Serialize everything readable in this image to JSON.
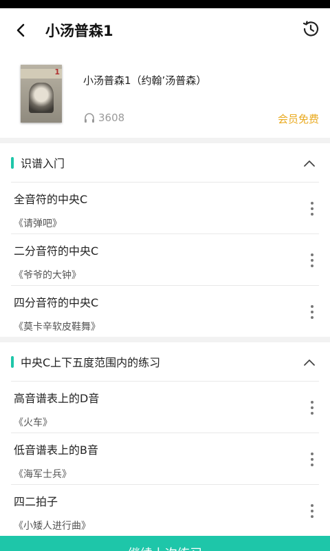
{
  "header": {
    "title": "小汤普森1",
    "back_icon": "back-arrow-icon",
    "history_icon": "history-clock-icon"
  },
  "book": {
    "title": "小汤普森1（约翰’汤普森）",
    "plays": "3608",
    "badge": "会员免费",
    "cover_number": "1",
    "badge_color": "#e9a91e"
  },
  "sections": [
    {
      "title": "识谱入门",
      "items": [
        {
          "name": "全音符的中央C",
          "sub": "《请弹吧》"
        },
        {
          "name": "二分音符的中央C",
          "sub": "《爷爷的大钟》"
        },
        {
          "name": "四分音符的中央C",
          "sub": "《莫卡辛软皮鞋舞》"
        }
      ]
    },
    {
      "title": "中央C上下五度范围内的练习",
      "items": [
        {
          "name": "高音谱表上的D音",
          "sub": "《火车》"
        },
        {
          "name": "低音谱表上的B音",
          "sub": "《海军士兵》"
        },
        {
          "name": "四二拍子",
          "sub": "《小矮人进行曲》"
        }
      ]
    }
  ],
  "bottom_button": {
    "label": "继续上次练习"
  },
  "accent_color": "#1ec6a9"
}
